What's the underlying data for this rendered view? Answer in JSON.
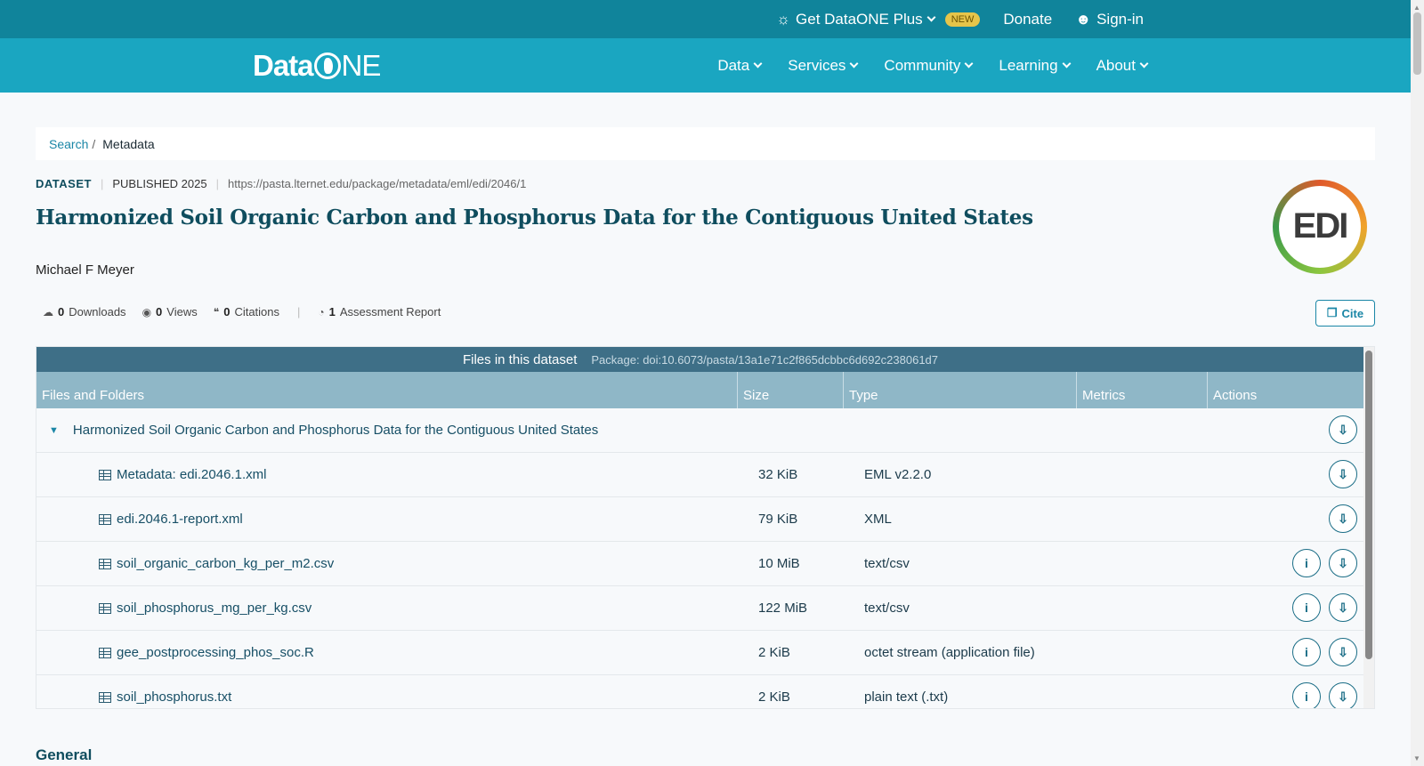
{
  "topbar": {
    "plus_label": "Get DataONE Plus",
    "new_badge": "NEW",
    "donate": "Donate",
    "signin": "Sign-in"
  },
  "nav": {
    "logo_left": "Data",
    "logo_right": "NE",
    "items": [
      "Data",
      "Services",
      "Community",
      "Learning",
      "About"
    ]
  },
  "breadcrumb": {
    "search": "Search",
    "separator": "/",
    "current": "Metadata"
  },
  "dataset": {
    "type_label": "DATASET",
    "published": "PUBLISHED 2025",
    "url": "https://pasta.lternet.edu/package/metadata/eml/edi/2046/1",
    "title": "Harmonized Soil Organic Carbon and Phosphorus Data for the Contiguous United States",
    "author": "Michael F Meyer",
    "repo_logo_text": "EDI"
  },
  "stats": {
    "downloads_count": "0",
    "downloads_label": "Downloads",
    "views_count": "0",
    "views_label": "Views",
    "citations_count": "0",
    "citations_label": "Citations",
    "assessment_count": "1",
    "assessment_label": "Assessment Report"
  },
  "cite_label": "Cite",
  "files": {
    "heading": "Files in this dataset",
    "package": "Package: doi:10.6073/pasta/13a1e71c2f865dcbbc6d692c238061d7",
    "columns": [
      "Files and Folders",
      "Size",
      "Type",
      "Metrics",
      "Actions"
    ],
    "package_name": "Harmonized Soil Organic Carbon and Phosphorus Data for the Contiguous United States",
    "rows": [
      {
        "name": "Metadata: edi.2046.1.xml",
        "size": "32 KiB",
        "type": "EML v2.2.0",
        "info": false
      },
      {
        "name": "edi.2046.1-report.xml",
        "size": "79 KiB",
        "type": "XML",
        "info": false
      },
      {
        "name": "soil_organic_carbon_kg_per_m2.csv",
        "size": "10 MiB",
        "type": "text/csv",
        "info": true
      },
      {
        "name": "soil_phosphorus_mg_per_kg.csv",
        "size": "122 MiB",
        "type": "text/csv",
        "info": true
      },
      {
        "name": "gee_postprocessing_phos_soc.R",
        "size": "2 KiB",
        "type": "octet stream (application file)",
        "info": true
      },
      {
        "name": "soil_phosphorus.txt",
        "size": "2 KiB",
        "type": "plain text (.txt)",
        "info": true
      }
    ]
  },
  "general_heading": "General",
  "colors": {
    "topbar": "#10849b",
    "nav": "#1aa6c1",
    "title": "#0f4d5e",
    "accent": "#1a86a6"
  }
}
